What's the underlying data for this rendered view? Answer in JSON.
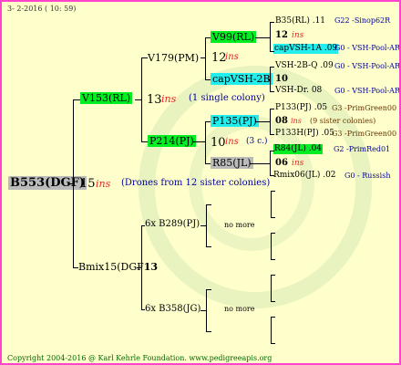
{
  "header": {
    "date": "3- 2-2016 ( 10: 59)"
  },
  "root": {
    "id": "B553(DGF)",
    "ins_num": "15",
    "ins_label": "ins",
    "note": "(Drones from 12 sister colonies)"
  },
  "queen": {
    "id": "V153(RL)",
    "ins_num": "13",
    "ins_label": "ins",
    "note": "(1 single colony)"
  },
  "v179": {
    "id": "V179(PM)",
    "ins_num": "12",
    "ins_label": "ins"
  },
  "p214": {
    "id": "P214(PJ)",
    "ins_num": "10",
    "ins_label": "ins",
    "note": "(3 c.)"
  },
  "v99": {
    "id": "V99(RL)"
  },
  "capvsh_2b": {
    "id": "capVSH-2B",
    "num": "10"
  },
  "p135": {
    "id": "P135(PJ)",
    "num": "08",
    "ins_label": "ins",
    "note": "(9 sister colonies)"
  },
  "r85": {
    "id": "R85(JL)",
    "num": "06",
    "ins_label": "ins"
  },
  "g4": [
    {
      "name": "B35(RL)",
      "yr": ".11",
      "code": "G22 -Sinop62R"
    },
    {
      "name": "12",
      "ins": "ins"
    },
    {
      "name": "capVSH-1A",
      "yr": ".09",
      "code": "G0 - VSH-Pool-AR"
    },
    {
      "name": "VSH-2B-Q",
      "yr": ".09",
      "code": "G0 - VSH-Pool-AR"
    },
    {
      "name": "VSH-Dr.",
      "yr": "08",
      "code": "G0 - VSH-Pool-AR"
    },
    {
      "name": "P133(PJ)",
      "yr": ".05",
      "code": "G3 -PrimGreen00"
    },
    {
      "name": "P133H(PJ)",
      "yr": ".05",
      "code": "G3 -PrimGreen00"
    },
    {
      "name": "R84(JL)",
      "yr": ".04",
      "code": "G2 -PrimRed01"
    },
    {
      "name": "Rmix06(JL)",
      "yr": ".02",
      "code": "G0 - Russish"
    }
  ],
  "drones": {
    "id_pre": "Bmix15(DGF",
    "id_post": "13"
  },
  "b289": {
    "id": "6x B289(PJ)",
    "note": "no more"
  },
  "b358": {
    "id": "6x B358(JG)",
    "note": "no more"
  },
  "footer": {
    "text": "Copyright 2004-2016 @ Karl Kehrle Foundation.   www.pedigreeapis.org"
  },
  "colors": {
    "green": "#00ee22",
    "cyan": "#22eeee",
    "gray": "#bbbbbb",
    "red": "#ee2222",
    "border": "#ff44cc",
    "background": "#ffffcc"
  }
}
